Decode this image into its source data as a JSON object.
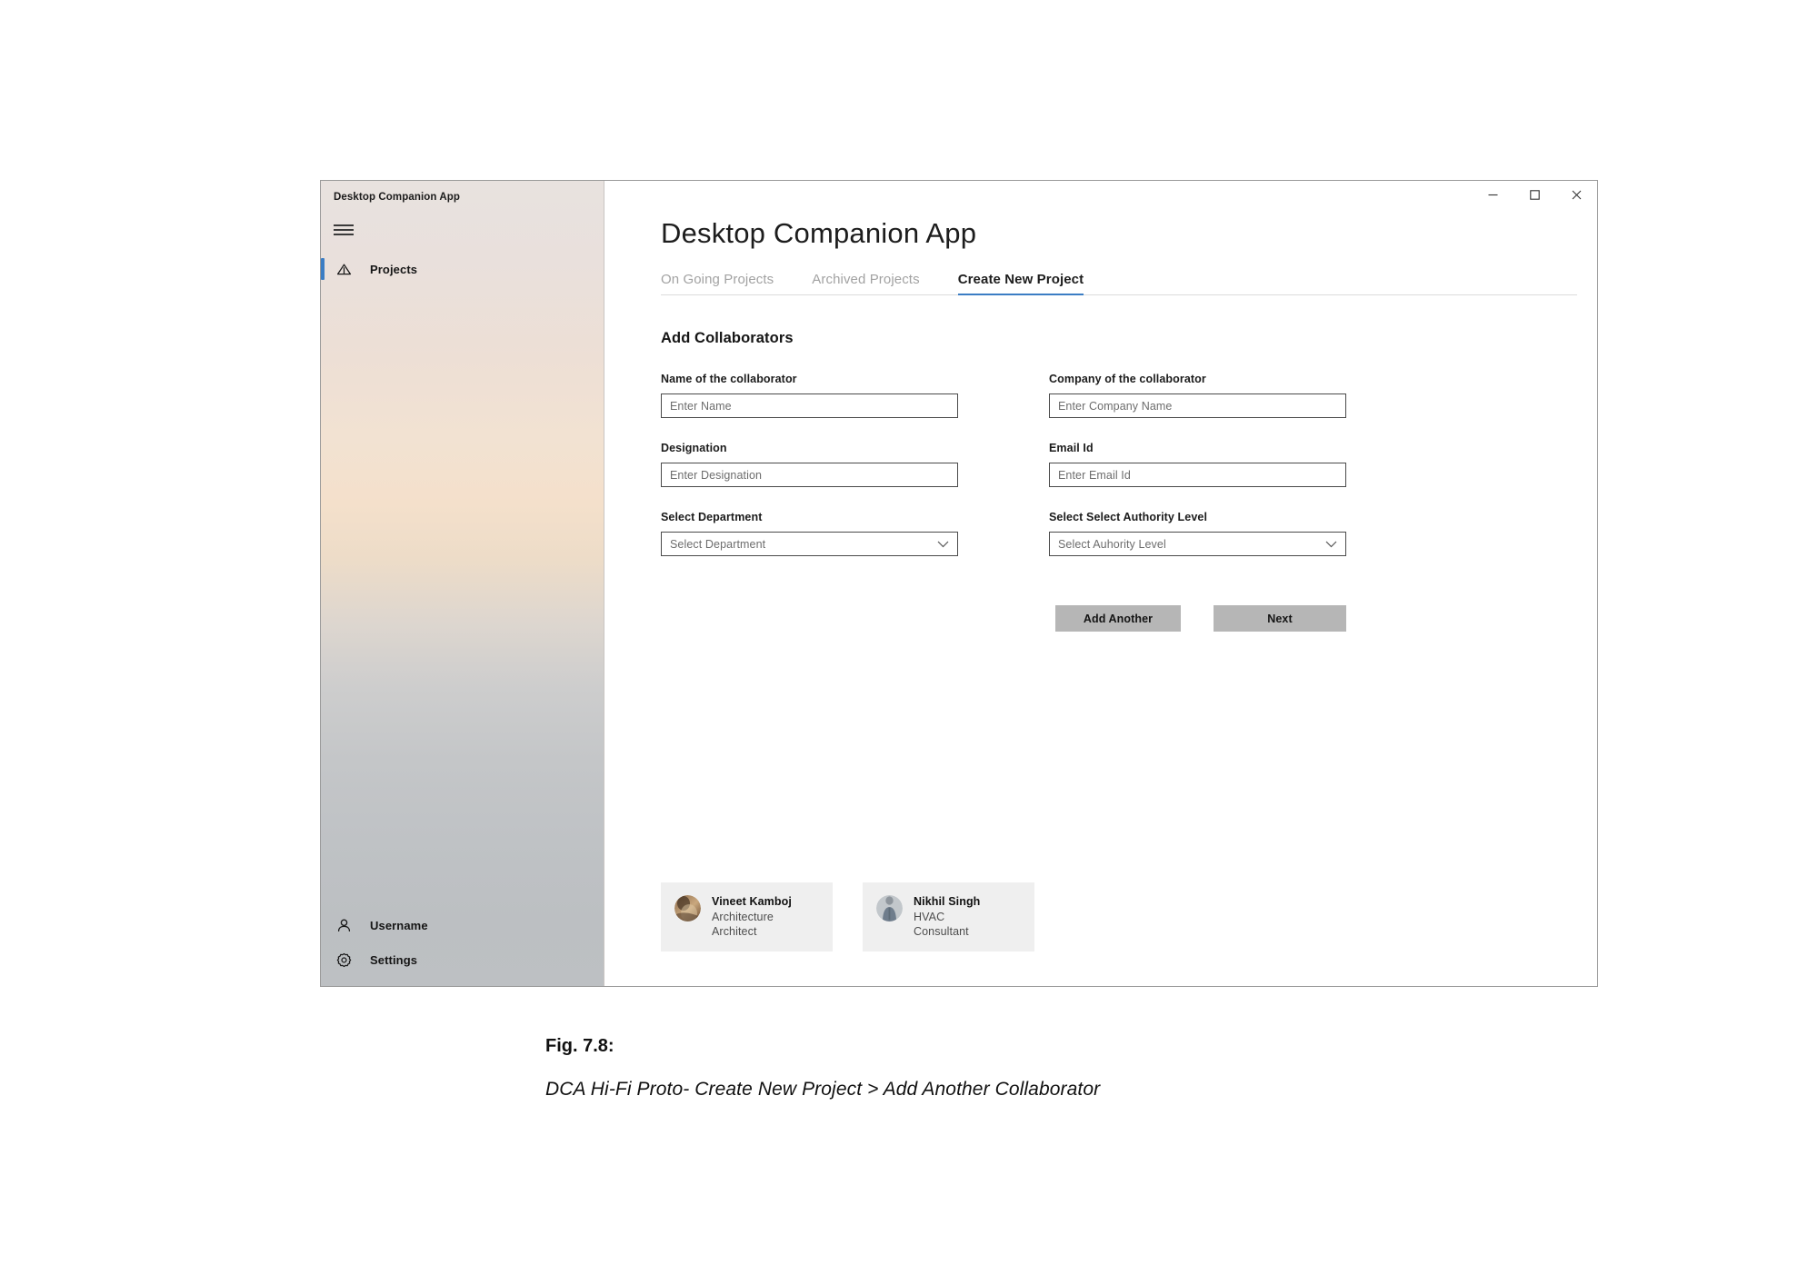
{
  "window": {
    "sidebar_title": "Desktop Companion App",
    "controls": [
      {
        "name": "minimize",
        "label": "—"
      },
      {
        "name": "maximize",
        "label": "□"
      },
      {
        "name": "close",
        "label": "✕"
      }
    ]
  },
  "sidebar": {
    "menu_icon": "hamburger-icon",
    "items": [
      {
        "label": "Projects",
        "icon": "projects-icon",
        "selected": true
      }
    ],
    "bottom_items": [
      {
        "label": "Username",
        "icon": "person-icon"
      },
      {
        "label": "Settings",
        "icon": "gear-icon"
      }
    ],
    "accent_color": "#3b7dc4"
  },
  "main": {
    "title": "Desktop Companion App",
    "tabs": [
      {
        "label": "On Going Projects",
        "active": false
      },
      {
        "label": "Archived Projects",
        "active": false
      },
      {
        "label": "Create New Project",
        "active": true
      }
    ],
    "section_title": "Add Collaborators",
    "fields": [
      {
        "label": "Name of the collaborator",
        "placeholder": "Enter Name",
        "value": "",
        "type": "text",
        "name": "collaborator-name"
      },
      {
        "label": "Company of the collaborator",
        "placeholder": "Enter Company Name",
        "value": "",
        "type": "text",
        "name": "collaborator-company"
      },
      {
        "label": "Designation",
        "placeholder": "Enter Designation",
        "value": "",
        "type": "text",
        "name": "collaborator-designation"
      },
      {
        "label": "Email Id",
        "placeholder": "Enter Email Id",
        "value": "",
        "type": "text",
        "name": "collaborator-email"
      },
      {
        "label": "Select Department",
        "placeholder": "Select Department",
        "value": "",
        "type": "select",
        "name": "department-select"
      },
      {
        "label": "Select Select Authority Level",
        "placeholder": "Select Auhority Level",
        "value": "",
        "type": "select",
        "name": "authority-level-select"
      }
    ],
    "buttons": {
      "add_another": "Add Another",
      "next": "Next"
    },
    "collaborators": [
      {
        "name": "Vineet Kamboj",
        "company": "Architecture",
        "role": "Architect",
        "avatar": "avatar-photo-warm"
      },
      {
        "name": "Nikhil Singh",
        "company": "HVAC",
        "role": "Consultant",
        "avatar": "avatar-photo-cool"
      }
    ]
  },
  "caption": {
    "number": "Fig. 7.8:",
    "text": "DCA Hi-Fi Proto- Create New Project > Add Another Collaborator"
  }
}
